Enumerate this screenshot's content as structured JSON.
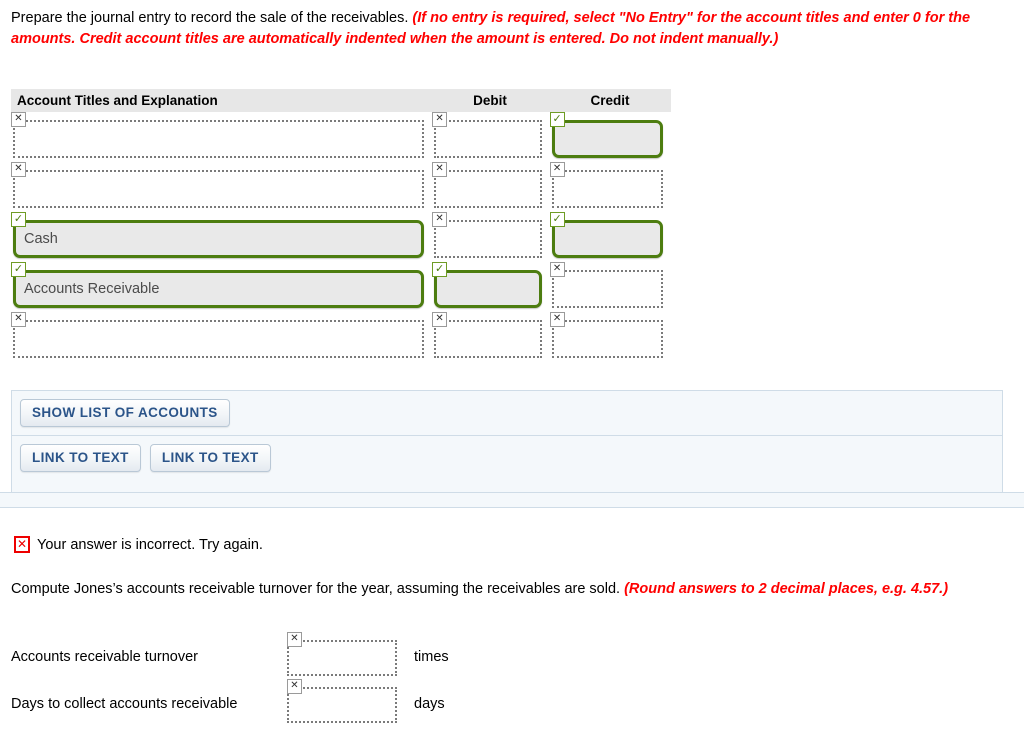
{
  "prompt": {
    "main": "Prepare the journal entry to record the sale of the receivables.",
    "hint": "(If no entry is required, select \"No Entry\" for the account titles and enter 0 for the amounts. Credit account titles are automatically indented when the amount is entered. Do not indent manually.)"
  },
  "journal_table": {
    "headers": {
      "account": "Account Titles and Explanation",
      "debit": "Debit",
      "credit": "Credit"
    },
    "rows": [
      {
        "account": "",
        "account_status": "wrong",
        "debit": "",
        "debit_status": "wrong",
        "credit": "",
        "credit_status": "right"
      },
      {
        "account": "",
        "account_status": "wrong",
        "debit": "",
        "debit_status": "wrong",
        "credit": "",
        "credit_status": "wrong"
      },
      {
        "account": "Cash",
        "account_status": "right",
        "debit": "",
        "debit_status": "wrong",
        "credit": "",
        "credit_status": "right"
      },
      {
        "account": "Accounts Receivable",
        "account_status": "right",
        "debit": "",
        "debit_status": "right",
        "credit": "",
        "credit_status": "wrong"
      },
      {
        "account": "",
        "account_status": "wrong",
        "debit": "",
        "debit_status": "wrong",
        "credit": "",
        "credit_status": "wrong"
      }
    ],
    "marker_glyphs": {
      "wrong": "✕",
      "right": "✓"
    }
  },
  "panel": {
    "show_list_label": "SHOW LIST OF ACCOUNTS",
    "link_to_text_1": "LINK TO TEXT",
    "link_to_text_2": "LINK TO TEXT"
  },
  "feedback": {
    "badge": "✕",
    "text": "Your answer is incorrect.  Try again."
  },
  "question2": {
    "main": "Compute Jones’s accounts receivable turnover for the year, assuming the receivables are sold.",
    "hint": "(Round answers to 2 decimal places, e.g. 4.57.)"
  },
  "answers": [
    {
      "label": "Accounts receivable turnover",
      "value": "",
      "unit": "times",
      "status": "wrong"
    },
    {
      "label": "Days to collect accounts receivable",
      "value": "",
      "unit": "days",
      "status": "wrong"
    }
  ],
  "colors": {
    "error_red": "#ff0000",
    "correct_green": "#4d7d10",
    "button_blue": "#2b5489",
    "header_gray": "#e7e7e7",
    "panel_blue": "#f4f8fb"
  }
}
